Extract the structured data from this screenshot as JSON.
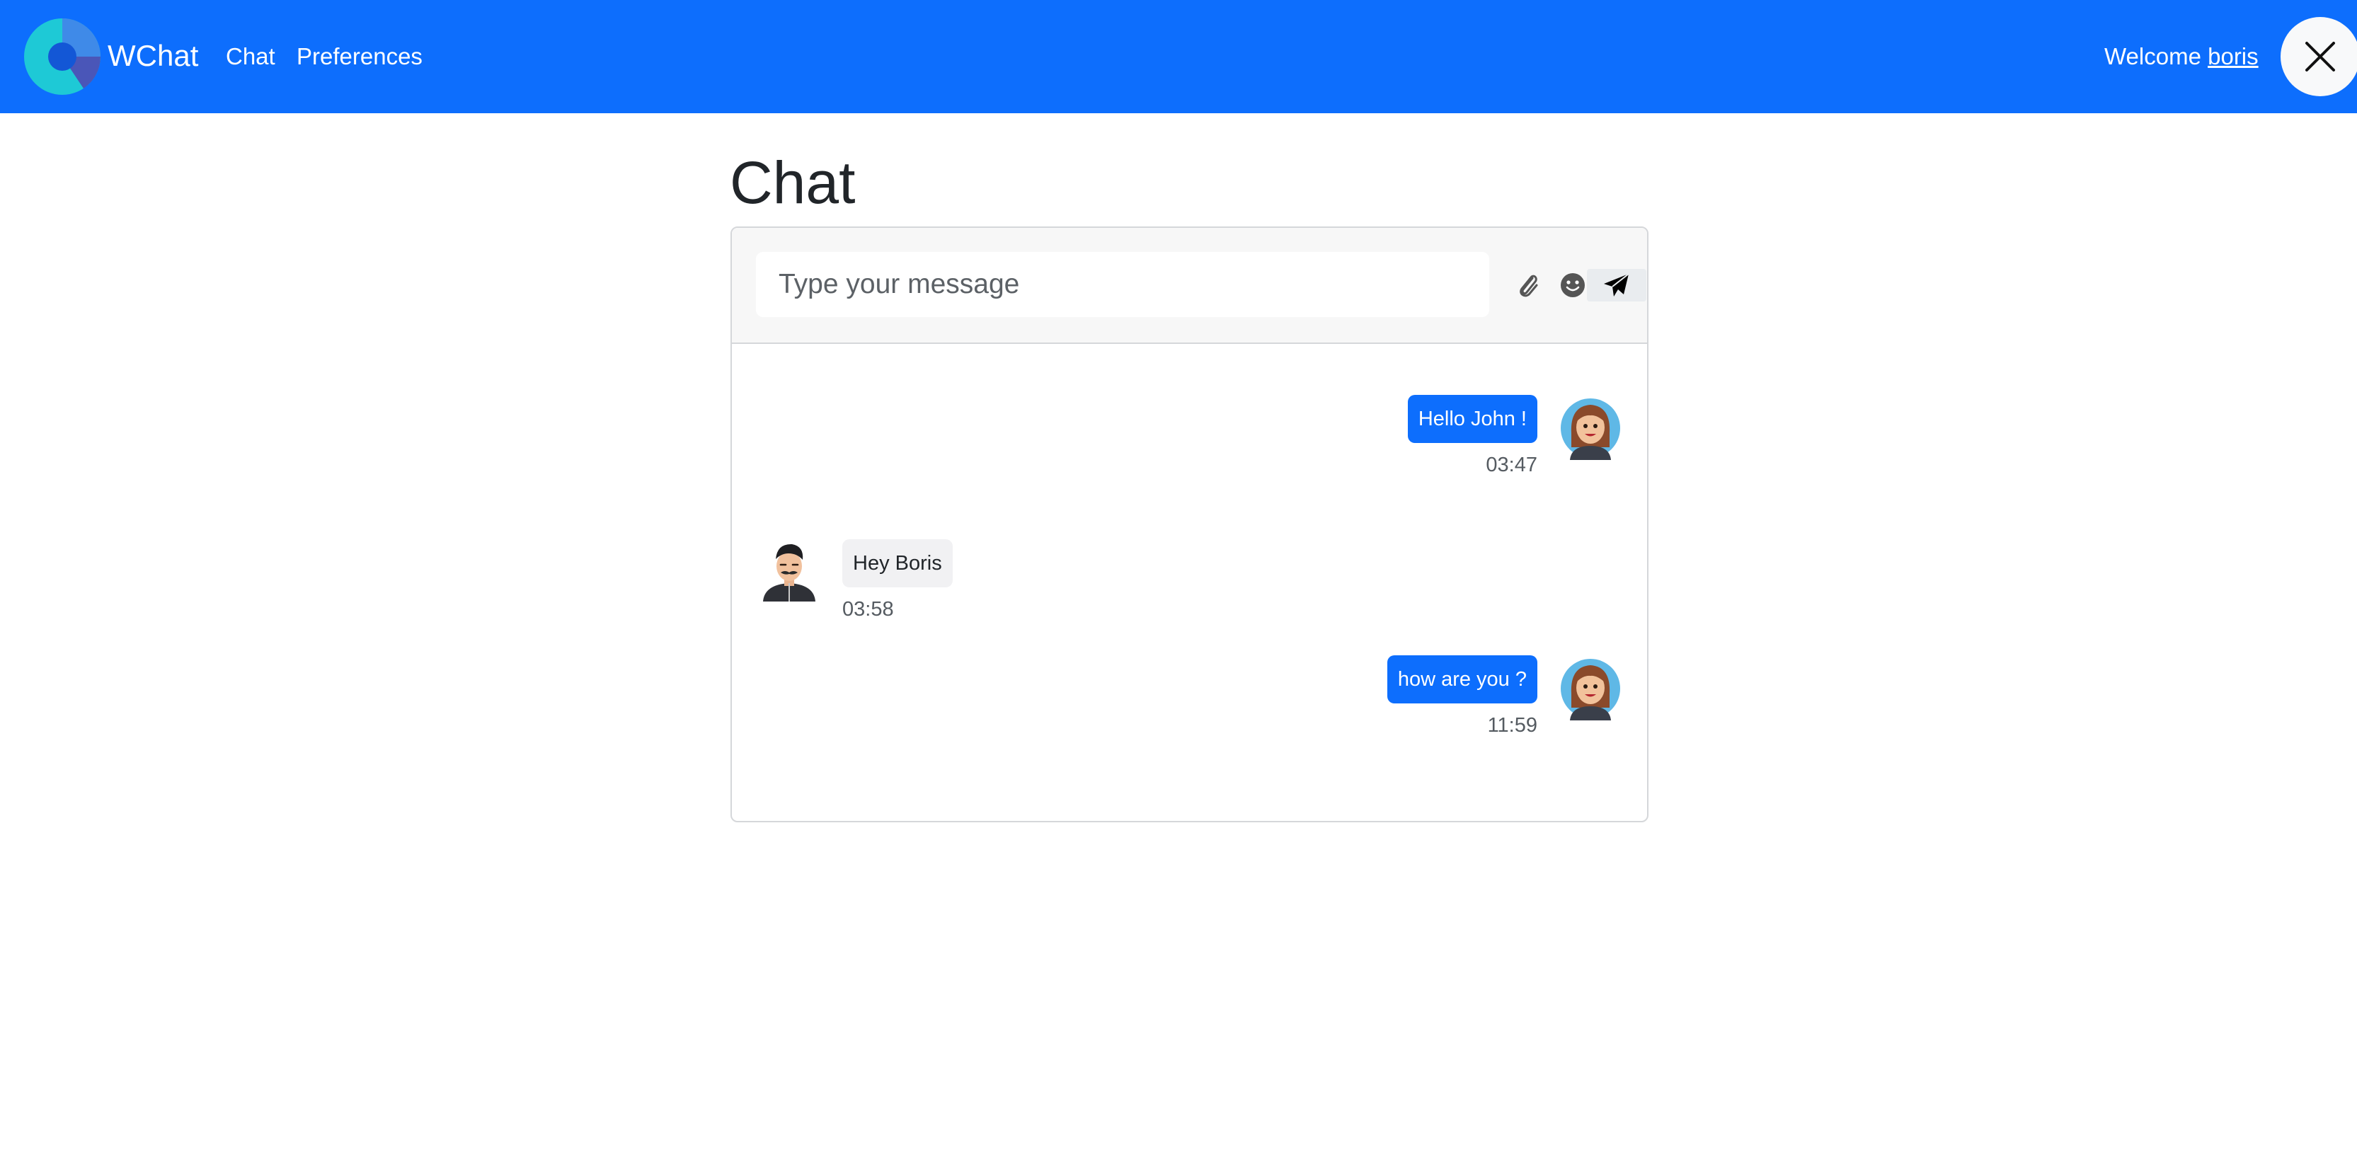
{
  "brand": {
    "name": "WChat",
    "logo_icon": "wchat-logo-icon"
  },
  "nav": {
    "items": [
      {
        "label": "Chat"
      },
      {
        "label": "Preferences"
      }
    ]
  },
  "header": {
    "welcome_text": "Welcome",
    "username": "boris",
    "close_icon": "close-icon"
  },
  "colors": {
    "primary": "#0d6efd",
    "navbar_text": "#ffffff",
    "incoming_bubble": "#f1f1f3",
    "panel_header": "#f7f7f7"
  },
  "page": {
    "title": "Chat"
  },
  "composer": {
    "value": "",
    "placeholder": "Type your message",
    "attach_icon": "paperclip-icon",
    "emoji_icon": "emoji-icon",
    "send_icon": "paper-plane-icon"
  },
  "messages": [
    {
      "direction": "outgoing",
      "text": "Hello John !",
      "time": "03:47",
      "avatar": "female-avatar-icon"
    },
    {
      "direction": "incoming",
      "text": "Hey Boris",
      "time": "03:58",
      "avatar": "male-avatar-icon"
    },
    {
      "direction": "outgoing",
      "text": "how are you ?",
      "time": "11:59",
      "avatar": "female-avatar-icon"
    }
  ]
}
